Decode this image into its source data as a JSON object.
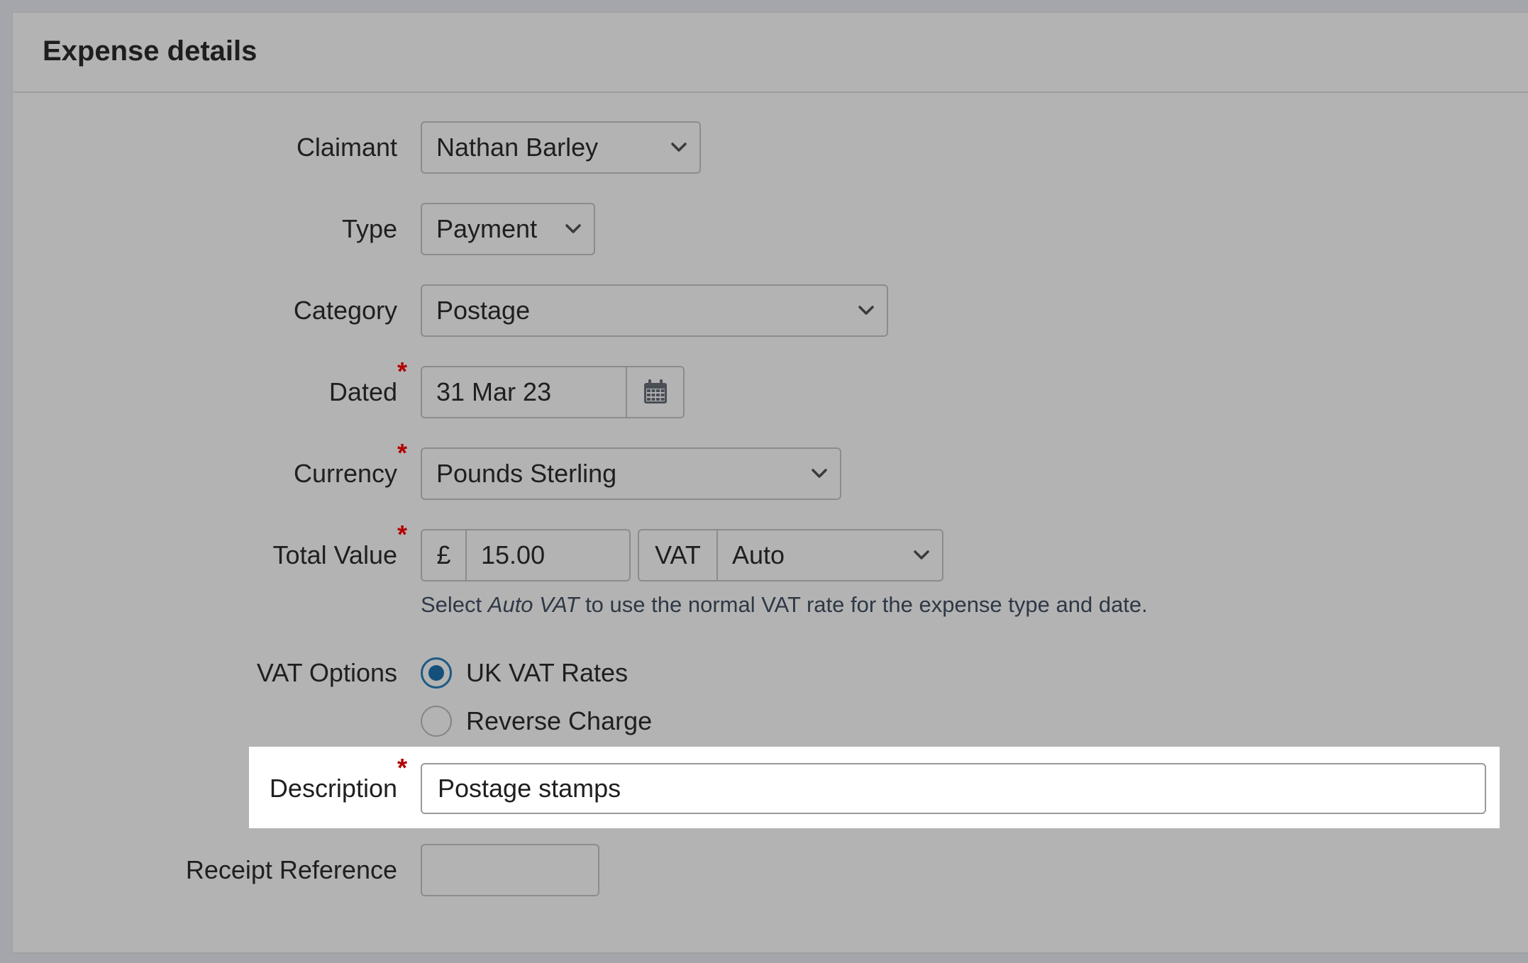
{
  "panel": {
    "title": "Expense details"
  },
  "form": {
    "claimant": {
      "label": "Claimant",
      "value": "Nathan Barley"
    },
    "type": {
      "label": "Type",
      "value": "Payment"
    },
    "category": {
      "label": "Category",
      "value": "Postage"
    },
    "dated": {
      "label": "Dated",
      "required_mark": "*",
      "value": "31 Mar 23"
    },
    "currency": {
      "label": "Currency",
      "required_mark": "*",
      "value": "Pounds Sterling"
    },
    "total_value": {
      "label": "Total Value",
      "required_mark": "*",
      "currency_symbol": "£",
      "amount": "15.00",
      "vat_label": "VAT",
      "vat_value": "Auto"
    },
    "help": {
      "prefix": "Select ",
      "emphasis": "Auto VAT",
      "suffix": " to use the normal VAT rate for the expense type and date."
    },
    "vat_options": {
      "label": "VAT Options",
      "options": [
        {
          "label": "UK VAT Rates",
          "selected": true
        },
        {
          "label": "Reverse Charge",
          "selected": false
        }
      ]
    },
    "description": {
      "label": "Description",
      "required_mark": "*",
      "value": "Postage stamps"
    },
    "receipt_reference": {
      "label": "Receipt Reference",
      "value": ""
    }
  },
  "colors": {
    "accent": "#14507a",
    "required": "#b30000"
  }
}
